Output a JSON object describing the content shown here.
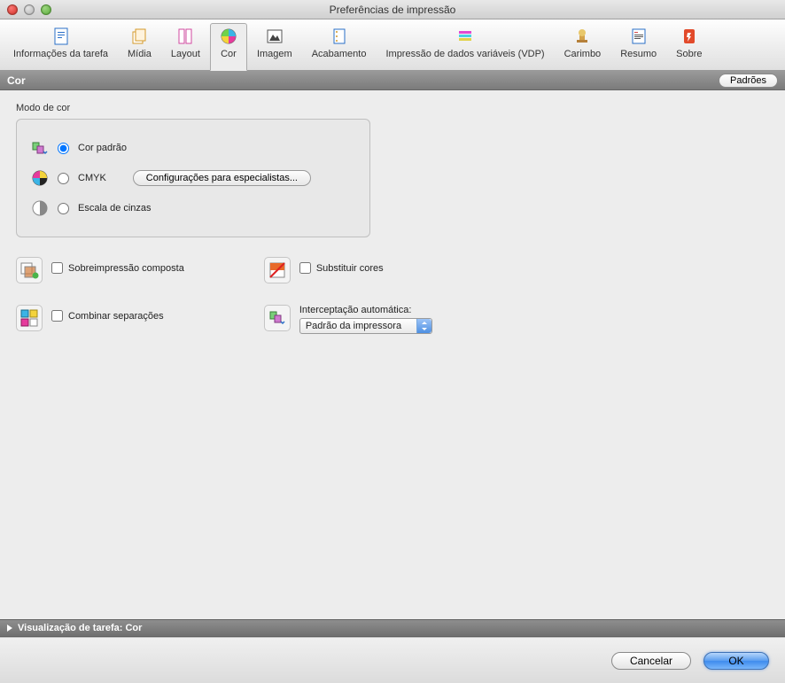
{
  "window": {
    "title": "Preferências de impressão"
  },
  "toolbar": {
    "items": [
      {
        "label": "Informações da tarefa",
        "key": "job-info"
      },
      {
        "label": "Mídia",
        "key": "media"
      },
      {
        "label": "Layout",
        "key": "layout"
      },
      {
        "label": "Cor",
        "key": "color"
      },
      {
        "label": "Imagem",
        "key": "image"
      },
      {
        "label": "Acabamento",
        "key": "finishing"
      },
      {
        "label": "Impressão de dados variáveis (VDP)",
        "key": "vdp"
      },
      {
        "label": "Carimbo",
        "key": "stamp"
      },
      {
        "label": "Resumo",
        "key": "summary"
      },
      {
        "label": "Sobre",
        "key": "about"
      }
    ],
    "selected": "color"
  },
  "section": {
    "title": "Cor",
    "defaults_label": "Padrões"
  },
  "color_mode": {
    "group_label": "Modo de cor",
    "options": {
      "standard": "Cor padrão",
      "cmyk": "CMYK",
      "grayscale": "Escala de cinzas"
    },
    "selected": "standard",
    "expert_button": "Configurações para especialistas..."
  },
  "options": {
    "composite_overprint": {
      "label": "Sobreimpressão composta",
      "checked": false
    },
    "combine_separations": {
      "label": "Combinar separações",
      "checked": false
    },
    "substitute_colors": {
      "label": "Substituir cores",
      "checked": false
    },
    "auto_trap": {
      "label": "Interceptação automática:",
      "value": "Padrão da impressora"
    }
  },
  "preview_bar": {
    "label": "Visualização de tarefa: Cor"
  },
  "buttons": {
    "cancel": "Cancelar",
    "ok": "OK"
  }
}
